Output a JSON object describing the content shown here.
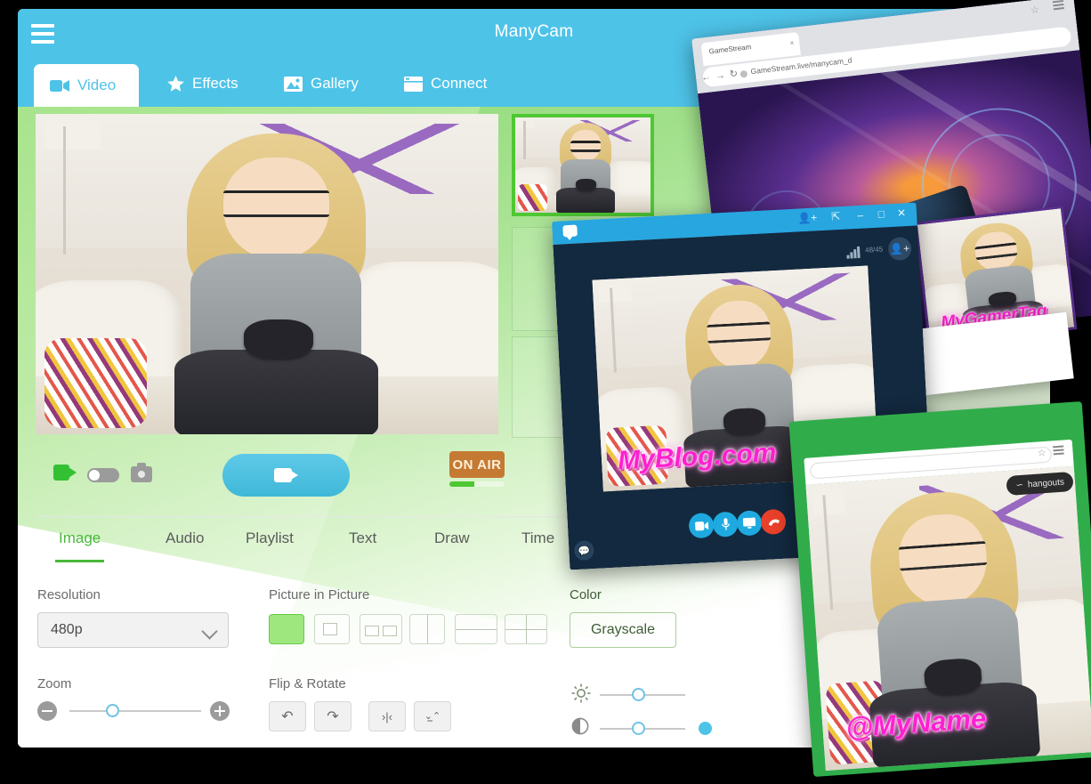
{
  "app": {
    "title": "ManyCam",
    "menu_icon": "hamburger-icon"
  },
  "top_tabs": [
    {
      "label": "Video",
      "icon": "video-camera-icon",
      "active": true
    },
    {
      "label": "Effects",
      "icon": "star-icon",
      "active": false
    },
    {
      "label": "Gallery",
      "icon": "image-icon",
      "active": false
    },
    {
      "label": "Connect",
      "icon": "browser-window-icon",
      "active": false
    }
  ],
  "controls": {
    "camera_icon": "video-camera-icon",
    "toggle_icon": "toggle-switch-off",
    "photo_icon": "camera-photo-icon",
    "record_icon": "video-camera-icon",
    "on_air_label": "ON AIR",
    "on_air_progress": 45
  },
  "lower_tabs": [
    {
      "label": "Image",
      "active": true
    },
    {
      "label": "Audio",
      "active": false
    },
    {
      "label": "Playlist",
      "active": false
    },
    {
      "label": "Text",
      "active": false
    },
    {
      "label": "Draw",
      "active": false
    },
    {
      "label": "Time",
      "active": false
    }
  ],
  "settings": {
    "resolution_label": "Resolution",
    "resolution_value": "480p",
    "pip_label": "Picture in Picture",
    "pip_selected_index": 0,
    "color_label": "Color",
    "color_value": "Grayscale",
    "zoom_label": "Zoom",
    "zoom_minus": "minus-icon",
    "zoom_plus": "plus-icon",
    "flip_label": "Flip & Rotate",
    "flip_buttons": [
      {
        "name": "rotate-left-button",
        "glyph": "↶"
      },
      {
        "name": "rotate-right-button",
        "glyph": "↷"
      },
      {
        "name": "flip-horizontal-button",
        "glyph": "›|‹"
      },
      {
        "name": "flip-vertical-button",
        "glyph": "⌄̲⌃"
      }
    ],
    "brightness_icon": "sun-icon",
    "contrast_icon": "contrast-half-circle-icon"
  },
  "gamestream_window": {
    "tab_title": "GameStream",
    "tab_close": "×",
    "nav_back": "←",
    "nav_forward": "→",
    "reload": "↻",
    "url": "GameStream.live/manycam_d",
    "star_icon": "bookmark-star-icon",
    "menu_icon": "chrome-menu-icon"
  },
  "gamertag_overlay": {
    "text": "MyGamerTag"
  },
  "skype_window": {
    "chat_icon": "skype-chat-icon",
    "window_controls": [
      "add-person-icon",
      "fullscreen-icon",
      "minimize-icon",
      "maximize-icon",
      "close-icon"
    ],
    "signal_icon": "signal-bars-icon",
    "bitrate": "48/45",
    "add_person_icon": "add-person-icon",
    "call_buttons": [
      {
        "name": "video-call-button",
        "glyph": "▶",
        "color": "#1eaae0"
      },
      {
        "name": "microphone-button",
        "glyph": "♀",
        "color": "#1eaae0"
      },
      {
        "name": "share-screen-button",
        "glyph": "▭",
        "color": "#1eaae0"
      },
      {
        "name": "hang-up-button",
        "glyph": "☎",
        "color": "#e8402a"
      }
    ],
    "extra_buttons": [
      {
        "name": "send-file-button",
        "glyph": "✉"
      },
      {
        "name": "more-options-button",
        "glyph": "•••"
      }
    ],
    "overlay_text": "MyBlog.com"
  },
  "hangouts_window": {
    "star_icon": "bookmark-star-icon",
    "menu_icon": "chrome-menu-icon",
    "pill_icon": "hangouts-icon",
    "pill_label": "hangouts",
    "overlay_text": "@MyName"
  },
  "colors": {
    "titlebar": "#4ec3e8",
    "accent_green": "#49b83a",
    "on_air": "#c57a33",
    "watermark_pink": "#ff1fd0",
    "skype_blue": "#27a6e0",
    "hangouts_green": "#30ad4a",
    "gamestream_purple": "#7a3fb8"
  }
}
